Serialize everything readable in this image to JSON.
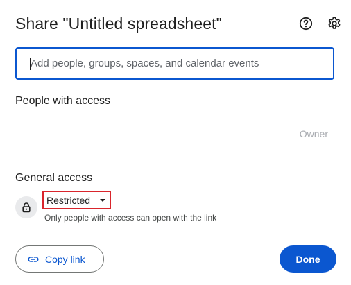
{
  "dialog": {
    "title": "Share \"Untitled spreadsheet\"",
    "help_icon": "help-circle-icon",
    "settings_icon": "gear-icon"
  },
  "search": {
    "placeholder": "Add people, groups, spaces, and calendar events",
    "value": ""
  },
  "people_section": {
    "heading": "People with access",
    "owner_label": "Owner"
  },
  "general_access": {
    "heading": "General access",
    "icon": "lock-icon",
    "selected_option": "Restricted",
    "description": "Only people with access can open with the link"
  },
  "footer": {
    "copy_link_label": "Copy link",
    "copy_link_icon": "link-icon",
    "done_label": "Done"
  },
  "colors": {
    "accent": "#0b57d0",
    "highlight_border": "#d9252c",
    "text_primary": "#1f1f1f",
    "text_muted": "#a8abb0"
  }
}
